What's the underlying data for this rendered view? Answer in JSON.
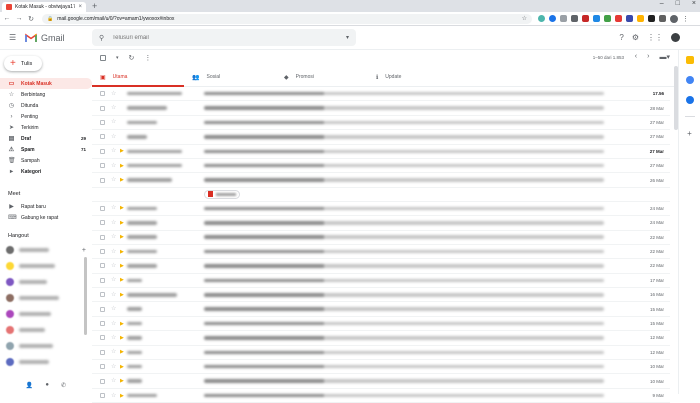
{
  "browser": {
    "tab_title": "Kotak Masuk - obviwjaya17@y...",
    "tab_close": "×",
    "new_tab": "+",
    "url": "mail.google.com/mail/u/0/?ov=amam1/ywoxox#inbox",
    "win": [
      "–",
      "□",
      "×"
    ]
  },
  "gmail": {
    "logo_text": "Gmail",
    "search_placeholder": "Telusuri email",
    "compose_label": "Tulis",
    "nav": [
      {
        "label": "Kotak Masuk",
        "count": "",
        "active": true
      },
      {
        "label": "Berbintang",
        "count": ""
      },
      {
        "label": "Ditunda",
        "count": ""
      },
      {
        "label": "Penting",
        "count": ""
      },
      {
        "label": "Terkirim",
        "count": ""
      },
      {
        "label": "Draf",
        "count": "29"
      },
      {
        "label": "Spam",
        "count": "71"
      },
      {
        "label": "Sampah",
        "count": ""
      },
      {
        "label": "Kategori",
        "count": ""
      }
    ],
    "meet_title": "Meet",
    "meet_items": [
      "Rapat baru",
      "Gabung ke rapat"
    ],
    "hangout_title": "Hangout",
    "hangout_add": "+",
    "range_text": "1–50 dari 1.853",
    "category_tabs": [
      "Utama",
      "Sosial",
      "Promosi",
      "Update"
    ],
    "dates": [
      "17.56",
      "28 Mar",
      "27 Mar",
      "27 Mar",
      "27 Mar",
      "27 Mar",
      "26 Mar",
      "24 Mar",
      "24 Mar",
      "22 Mar",
      "22 Mar",
      "22 Mar",
      "17 Mar",
      "16 Mar",
      "15 Mar",
      "15 Mar",
      "12 Mar",
      "12 Mar",
      "10 Mar",
      "10 Mar",
      "9 Mar",
      "8 Mar"
    ]
  }
}
